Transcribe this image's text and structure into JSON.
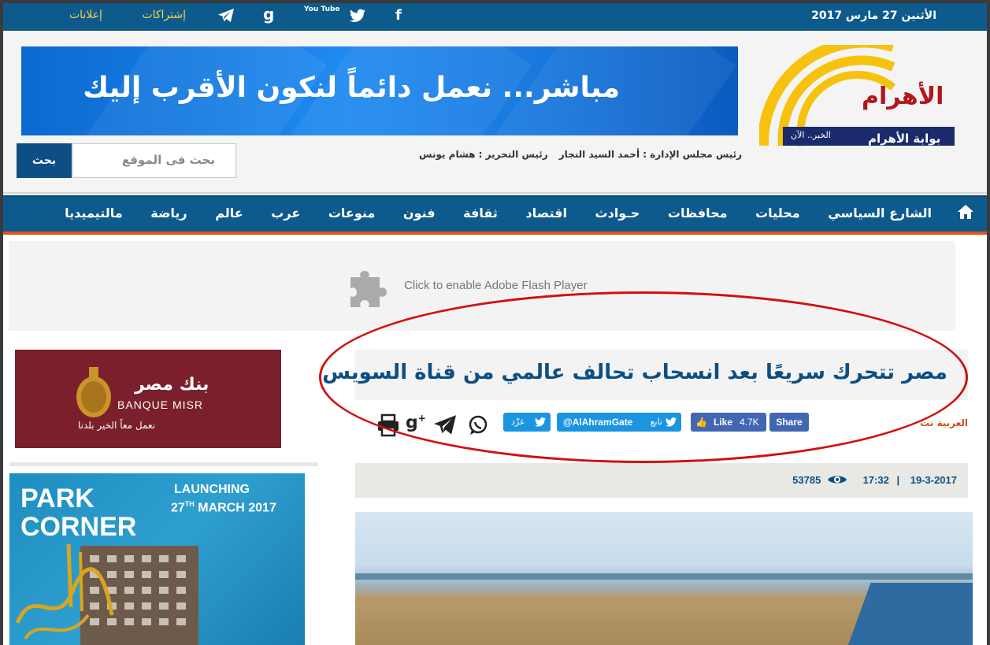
{
  "topbar": {
    "date": "الأثنين 27 مارس 2017",
    "links": [
      "إشتراكات",
      "إعلانات"
    ],
    "social_icons": [
      "facebook-icon",
      "twitter-icon",
      "youtube-icon",
      "google-icon",
      "telegram-icon"
    ],
    "social_glyphs": {
      "facebook": "f",
      "youtube": "You Tube",
      "google": "g"
    }
  },
  "header": {
    "logo": {
      "name": "الأهرام",
      "tagline": "الخبر.. الآن",
      "site": "بوابة الأهرام"
    },
    "banner_text": "مباشر... نعمل دائماً لنكون الأقرب إليك",
    "search_placeholder": "بحث فى الموقع",
    "search_button": "بحث",
    "chairman": "رئيس مجلس الإدارة : أحمد السيد النجار",
    "editor": "رئيس التحرير : هشام يونس"
  },
  "nav": {
    "items": [
      "الشارع السياسي",
      "محليات",
      "محافظات",
      "حـوادث",
      "اقتصاد",
      "ثقافة",
      "فنون",
      "منوعات",
      "عرب",
      "عالم",
      "رياضة",
      "مالتيميديا"
    ]
  },
  "flash": {
    "text": "Click to enable Adobe Flash Player"
  },
  "ads": {
    "banque_misr": {
      "arabic": "بنك مصر",
      "latin": "BANQUE MISR",
      "slogan": "نعمل معاً الخير بلدنا"
    },
    "park_corner": {
      "line1": "PARK",
      "line2": "CORNER",
      "launch": "LAUNCHING",
      "date_day": "27",
      "date_suffix": "TH",
      "date_rest": "MARCH 2017"
    }
  },
  "article": {
    "title": "مصر تتحرك سريعًا بعد انسحاب تحالف عالمي من قناة السويس",
    "source": "العربية نت",
    "share": {
      "fb_share": "Share",
      "fb_like": "Like",
      "fb_count": "4.7K",
      "follow_label": "تابع",
      "follow_handle": "@AlAhramGate",
      "tweet": "غرِّد"
    },
    "date": "19-3-2017",
    "time": "17:32",
    "separator": "|",
    "views": "53785"
  }
}
